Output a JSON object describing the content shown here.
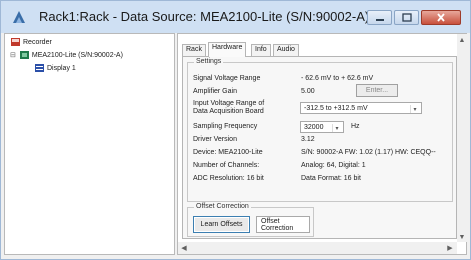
{
  "window": {
    "title": "Rack1:Rack - Data Source: MEA2100-Lite (S/N:90002-A)",
    "controls": {
      "minimize": "–",
      "maximize": "□",
      "close": "✕"
    }
  },
  "tree": {
    "root": {
      "label": "Recorder",
      "icon": "recorder-icon"
    },
    "device": {
      "expander": "⊟",
      "label": "MEA2100-Lite (S/N:90002-A)",
      "icon": "device-icon"
    },
    "display": {
      "label": "Display 1",
      "icon": "display-icon"
    }
  },
  "tabs": [
    {
      "label": "Rack",
      "active": false
    },
    {
      "label": "Hardware",
      "active": true
    },
    {
      "label": "Info",
      "active": false
    },
    {
      "label": "Audio",
      "active": false
    }
  ],
  "settings": {
    "title": "Settings",
    "signal_voltage_range": {
      "label": "Signal Voltage Range",
      "value": "- 62.6 mV to + 62.6 mV"
    },
    "amplifier_gain": {
      "label": "Amplifier Gain",
      "value": "5.00",
      "button": "Enter..."
    },
    "input_voltage_range": {
      "label_line1": "Input Voltage Range of",
      "label_line2": "Data Acquisition Board",
      "value": "-312.5 to +312.5 mV"
    },
    "sampling_frequency": {
      "label": "Sampling Frequency",
      "value": "32000",
      "unit": "Hz"
    },
    "driver_version": {
      "label": "Driver Version",
      "value": "3.12"
    },
    "device": {
      "label": "Device: MEA2100-Lite",
      "value": "S/N: 90002-A FW: 1.02 (1.17) HW: CEQQ--"
    },
    "channels": {
      "label": "Number of Channels:",
      "value": "Analog: 64, Digital: 1"
    },
    "adc": {
      "label": "ADC Resolution: 16 bit",
      "value": "Data Format: 16 bit"
    }
  },
  "offset": {
    "title": "Offset Correction",
    "learn_button": "Learn Offsets",
    "correction_label": "Offset Correction"
  },
  "scroll": {
    "up": "▲",
    "down": "▼",
    "left": "◀",
    "right": "▶"
  },
  "colors": {
    "accent": "#3c7fb1",
    "titlebar": "#cfe0f3",
    "close": "#c8503c"
  }
}
